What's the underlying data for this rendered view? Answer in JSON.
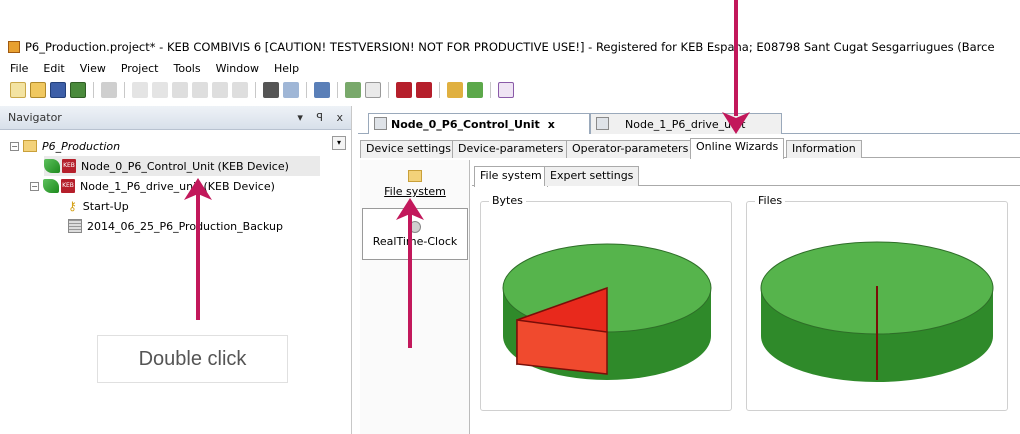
{
  "window": {
    "title": "P6_Production.project* - KEB COMBIVIS 6  [CAUTION! TESTVERSION! NOT FOR PRODUCTIVE USE!]   - Registered for KEB Espana; E08798 Sant Cugat Sesgarriugues (Barce"
  },
  "menu": [
    "File",
    "Edit",
    "View",
    "Project",
    "Tools",
    "Window",
    "Help"
  ],
  "navigator": {
    "title": "Navigator",
    "pin": "ᵖ",
    "close": "x",
    "dropdown": "▾",
    "tree": {
      "project": "P6_Production",
      "node0": {
        "name": "Node_0_P6_Control_Unit",
        "type": "(KEB Device)"
      },
      "node1": {
        "name": "Node_1_P6_drive_unit",
        "type": "(KEB Device)"
      },
      "startup": "Start-Up",
      "backup": "2014_06_25_P6_Production_Backup"
    }
  },
  "annotation": {
    "label": "Double click",
    "accent_color": "#c2185b"
  },
  "editor_tabs": [
    {
      "label": "Node_0_P6_Control_Unit",
      "close": "x"
    },
    {
      "label": "Node_1_P6_drive_unit"
    }
  ],
  "sub_tabs": [
    "Device settings",
    "Device-parameters",
    "Operator-parameters",
    "Online Wizards",
    "Information"
  ],
  "wizards": [
    "File system",
    "RealTime-Clock"
  ],
  "inner_tabs": [
    "File system",
    "Expert settings"
  ],
  "groups": {
    "bytes": "Bytes",
    "files": "Files"
  },
  "chart_colors": {
    "free": "#3f9a3a",
    "used": "#e8291c"
  }
}
